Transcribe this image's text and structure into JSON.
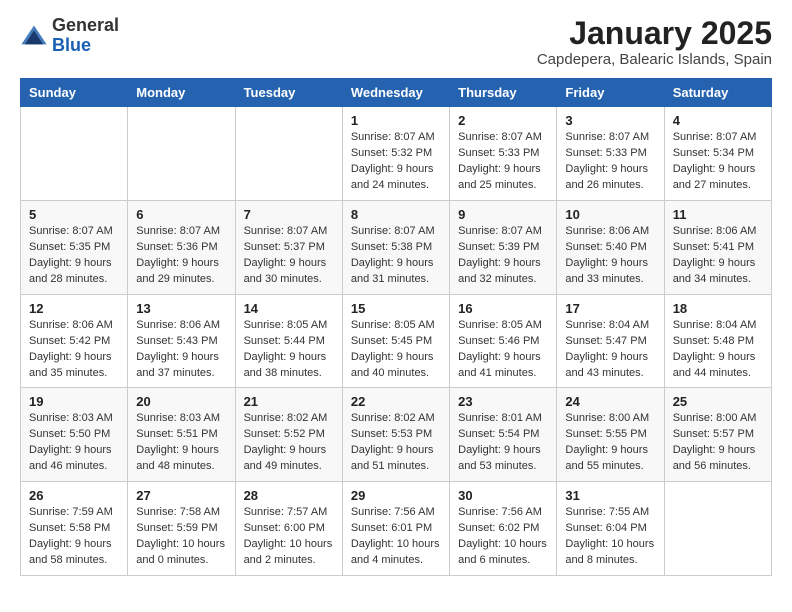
{
  "logo": {
    "text_general": "General",
    "text_blue": "Blue"
  },
  "header": {
    "title": "January 2025",
    "subtitle": "Capdepera, Balearic Islands, Spain"
  },
  "weekdays": [
    "Sunday",
    "Monday",
    "Tuesday",
    "Wednesday",
    "Thursday",
    "Friday",
    "Saturday"
  ],
  "weeks": [
    [
      {
        "day": "",
        "sunrise": "",
        "sunset": "",
        "daylight": ""
      },
      {
        "day": "",
        "sunrise": "",
        "sunset": "",
        "daylight": ""
      },
      {
        "day": "",
        "sunrise": "",
        "sunset": "",
        "daylight": ""
      },
      {
        "day": "1",
        "sunrise": "Sunrise: 8:07 AM",
        "sunset": "Sunset: 5:32 PM",
        "daylight": "Daylight: 9 hours and 24 minutes."
      },
      {
        "day": "2",
        "sunrise": "Sunrise: 8:07 AM",
        "sunset": "Sunset: 5:33 PM",
        "daylight": "Daylight: 9 hours and 25 minutes."
      },
      {
        "day": "3",
        "sunrise": "Sunrise: 8:07 AM",
        "sunset": "Sunset: 5:33 PM",
        "daylight": "Daylight: 9 hours and 26 minutes."
      },
      {
        "day": "4",
        "sunrise": "Sunrise: 8:07 AM",
        "sunset": "Sunset: 5:34 PM",
        "daylight": "Daylight: 9 hours and 27 minutes."
      }
    ],
    [
      {
        "day": "5",
        "sunrise": "Sunrise: 8:07 AM",
        "sunset": "Sunset: 5:35 PM",
        "daylight": "Daylight: 9 hours and 28 minutes."
      },
      {
        "day": "6",
        "sunrise": "Sunrise: 8:07 AM",
        "sunset": "Sunset: 5:36 PM",
        "daylight": "Daylight: 9 hours and 29 minutes."
      },
      {
        "day": "7",
        "sunrise": "Sunrise: 8:07 AM",
        "sunset": "Sunset: 5:37 PM",
        "daylight": "Daylight: 9 hours and 30 minutes."
      },
      {
        "day": "8",
        "sunrise": "Sunrise: 8:07 AM",
        "sunset": "Sunset: 5:38 PM",
        "daylight": "Daylight: 9 hours and 31 minutes."
      },
      {
        "day": "9",
        "sunrise": "Sunrise: 8:07 AM",
        "sunset": "Sunset: 5:39 PM",
        "daylight": "Daylight: 9 hours and 32 minutes."
      },
      {
        "day": "10",
        "sunrise": "Sunrise: 8:06 AM",
        "sunset": "Sunset: 5:40 PM",
        "daylight": "Daylight: 9 hours and 33 minutes."
      },
      {
        "day": "11",
        "sunrise": "Sunrise: 8:06 AM",
        "sunset": "Sunset: 5:41 PM",
        "daylight": "Daylight: 9 hours and 34 minutes."
      }
    ],
    [
      {
        "day": "12",
        "sunrise": "Sunrise: 8:06 AM",
        "sunset": "Sunset: 5:42 PM",
        "daylight": "Daylight: 9 hours and 35 minutes."
      },
      {
        "day": "13",
        "sunrise": "Sunrise: 8:06 AM",
        "sunset": "Sunset: 5:43 PM",
        "daylight": "Daylight: 9 hours and 37 minutes."
      },
      {
        "day": "14",
        "sunrise": "Sunrise: 8:05 AM",
        "sunset": "Sunset: 5:44 PM",
        "daylight": "Daylight: 9 hours and 38 minutes."
      },
      {
        "day": "15",
        "sunrise": "Sunrise: 8:05 AM",
        "sunset": "Sunset: 5:45 PM",
        "daylight": "Daylight: 9 hours and 40 minutes."
      },
      {
        "day": "16",
        "sunrise": "Sunrise: 8:05 AM",
        "sunset": "Sunset: 5:46 PM",
        "daylight": "Daylight: 9 hours and 41 minutes."
      },
      {
        "day": "17",
        "sunrise": "Sunrise: 8:04 AM",
        "sunset": "Sunset: 5:47 PM",
        "daylight": "Daylight: 9 hours and 43 minutes."
      },
      {
        "day": "18",
        "sunrise": "Sunrise: 8:04 AM",
        "sunset": "Sunset: 5:48 PM",
        "daylight": "Daylight: 9 hours and 44 minutes."
      }
    ],
    [
      {
        "day": "19",
        "sunrise": "Sunrise: 8:03 AM",
        "sunset": "Sunset: 5:50 PM",
        "daylight": "Daylight: 9 hours and 46 minutes."
      },
      {
        "day": "20",
        "sunrise": "Sunrise: 8:03 AM",
        "sunset": "Sunset: 5:51 PM",
        "daylight": "Daylight: 9 hours and 48 minutes."
      },
      {
        "day": "21",
        "sunrise": "Sunrise: 8:02 AM",
        "sunset": "Sunset: 5:52 PM",
        "daylight": "Daylight: 9 hours and 49 minutes."
      },
      {
        "day": "22",
        "sunrise": "Sunrise: 8:02 AM",
        "sunset": "Sunset: 5:53 PM",
        "daylight": "Daylight: 9 hours and 51 minutes."
      },
      {
        "day": "23",
        "sunrise": "Sunrise: 8:01 AM",
        "sunset": "Sunset: 5:54 PM",
        "daylight": "Daylight: 9 hours and 53 minutes."
      },
      {
        "day": "24",
        "sunrise": "Sunrise: 8:00 AM",
        "sunset": "Sunset: 5:55 PM",
        "daylight": "Daylight: 9 hours and 55 minutes."
      },
      {
        "day": "25",
        "sunrise": "Sunrise: 8:00 AM",
        "sunset": "Sunset: 5:57 PM",
        "daylight": "Daylight: 9 hours and 56 minutes."
      }
    ],
    [
      {
        "day": "26",
        "sunrise": "Sunrise: 7:59 AM",
        "sunset": "Sunset: 5:58 PM",
        "daylight": "Daylight: 9 hours and 58 minutes."
      },
      {
        "day": "27",
        "sunrise": "Sunrise: 7:58 AM",
        "sunset": "Sunset: 5:59 PM",
        "daylight": "Daylight: 10 hours and 0 minutes."
      },
      {
        "day": "28",
        "sunrise": "Sunrise: 7:57 AM",
        "sunset": "Sunset: 6:00 PM",
        "daylight": "Daylight: 10 hours and 2 minutes."
      },
      {
        "day": "29",
        "sunrise": "Sunrise: 7:56 AM",
        "sunset": "Sunset: 6:01 PM",
        "daylight": "Daylight: 10 hours and 4 minutes."
      },
      {
        "day": "30",
        "sunrise": "Sunrise: 7:56 AM",
        "sunset": "Sunset: 6:02 PM",
        "daylight": "Daylight: 10 hours and 6 minutes."
      },
      {
        "day": "31",
        "sunrise": "Sunrise: 7:55 AM",
        "sunset": "Sunset: 6:04 PM",
        "daylight": "Daylight: 10 hours and 8 minutes."
      },
      {
        "day": "",
        "sunrise": "",
        "sunset": "",
        "daylight": ""
      }
    ]
  ]
}
